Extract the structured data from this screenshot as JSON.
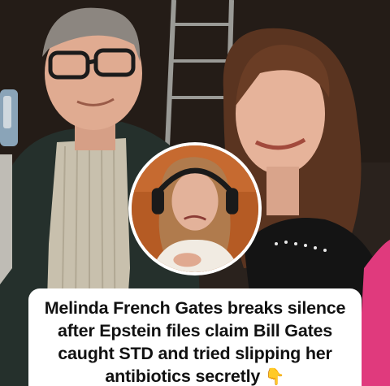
{
  "headline": {
    "text": "Melinda French Gates breaks silence after Epstein files claim Bill Gates caught STD and tried slipping her antibiotics secretly",
    "emoji": "👇"
  },
  "colors": {
    "caption_bg": "#ffffff",
    "headline_text": "#111111",
    "inset_border": "#ffffff",
    "emoji": "#f2b21b"
  },
  "icons": [
    "pointing-down-hand-emoji"
  ]
}
